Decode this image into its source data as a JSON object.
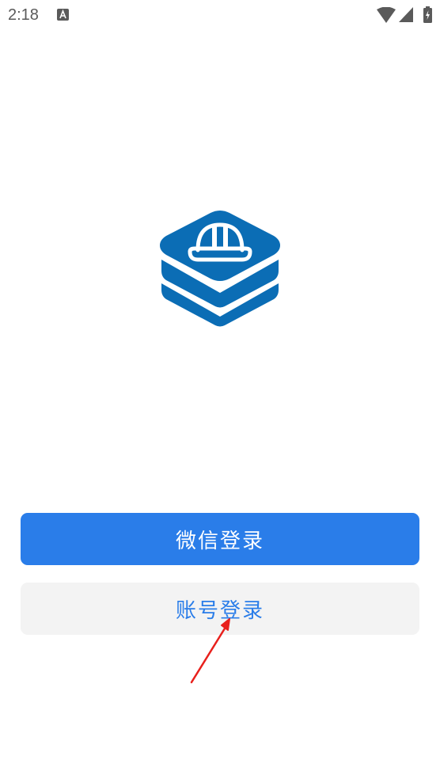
{
  "status_bar": {
    "time": "2:18",
    "notification_icon": "font-a-icon",
    "wifi_icon": "wifi-icon",
    "signal_icon": "cellular-signal-icon",
    "battery_icon": "battery-charging-icon"
  },
  "logo": {
    "icon": "hard-hat-stack-logo",
    "color": "#0b6db5"
  },
  "buttons": {
    "wechat_login": "微信登录",
    "account_login": "账号登录"
  },
  "colors": {
    "primary": "#2a7de9",
    "secondary_bg": "#f3f3f3",
    "annotation": "#e8201c"
  }
}
